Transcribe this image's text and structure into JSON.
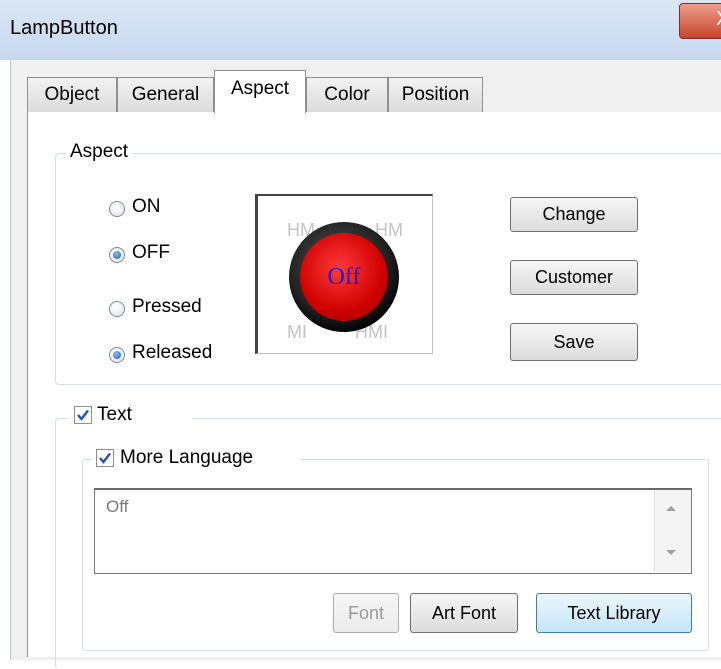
{
  "window": {
    "title": "LampButton",
    "close_glyph": "X"
  },
  "tabs": [
    {
      "label": "Object"
    },
    {
      "label": "General"
    },
    {
      "label": "Aspect",
      "active": true
    },
    {
      "label": "Color"
    },
    {
      "label": "Position"
    }
  ],
  "aspect": {
    "group_label": "Aspect",
    "state_options": [
      {
        "label": "ON",
        "selected": false
      },
      {
        "label": "OFF",
        "selected": true
      }
    ],
    "action_options": [
      {
        "label": "Pressed",
        "selected": false
      },
      {
        "label": "Released",
        "selected": true
      }
    ],
    "preview": {
      "lamp_text": "Off",
      "ghost_text": [
        "HM",
        "HM",
        "MI",
        "HMI"
      ]
    },
    "buttons": {
      "change": "Change",
      "customer": "Customer",
      "save": "Save"
    }
  },
  "text_group": {
    "label": "Text",
    "checked": true,
    "more_language": {
      "label": "More Language",
      "checked": true
    },
    "value": "Off",
    "buttons": {
      "font": "Font",
      "art_font": "Art Font",
      "text_library": "Text Library"
    }
  },
  "colors": {
    "lamp": "#d00000",
    "lamp_text": "#1a1acb",
    "accent": "#1f57a6"
  }
}
